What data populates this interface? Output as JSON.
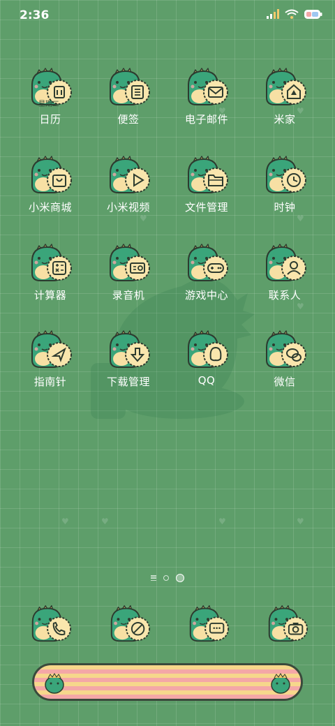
{
  "status": {
    "time": "2:36"
  },
  "apps": [
    {
      "id": "calendar",
      "label": "日历",
      "icon": "calendar-icon",
      "sub": "星期二"
    },
    {
      "id": "notes",
      "label": "便签",
      "icon": "notes-icon"
    },
    {
      "id": "email",
      "label": "电子邮件",
      "icon": "mail-icon"
    },
    {
      "id": "mihome",
      "label": "米家",
      "icon": "home-icon"
    },
    {
      "id": "mistore",
      "label": "小米商城",
      "icon": "bag-icon"
    },
    {
      "id": "mivideo",
      "label": "小米视频",
      "icon": "play-icon"
    },
    {
      "id": "files",
      "label": "文件管理",
      "icon": "folder-icon"
    },
    {
      "id": "clock",
      "label": "时钟",
      "icon": "clock-icon"
    },
    {
      "id": "calculator",
      "label": "计算器",
      "icon": "calculator-icon"
    },
    {
      "id": "recorder",
      "label": "录音机",
      "icon": "recorder-icon"
    },
    {
      "id": "games",
      "label": "游戏中心",
      "icon": "gamepad-icon"
    },
    {
      "id": "contacts",
      "label": "联系人",
      "icon": "person-icon"
    },
    {
      "id": "compass",
      "label": "指南针",
      "icon": "compass-icon"
    },
    {
      "id": "downloads",
      "label": "下载管理",
      "icon": "download-icon"
    },
    {
      "id": "qq",
      "label": "QQ",
      "icon": "qq-icon"
    },
    {
      "id": "wechat",
      "label": "微信",
      "icon": "wechat-icon"
    }
  ],
  "dock": [
    {
      "id": "phone",
      "icon": "phone-icon"
    },
    {
      "id": "browser",
      "icon": "browser-icon"
    },
    {
      "id": "messages",
      "icon": "message-icon"
    },
    {
      "id": "camera",
      "icon": "camera-icon"
    }
  ],
  "pager": {
    "pages": 2,
    "current": 2
  },
  "colors": {
    "background": "#5e9e6a",
    "dino": "#3aa57a",
    "badge": "#f9e6ad",
    "outline": "#2d3b2f"
  }
}
